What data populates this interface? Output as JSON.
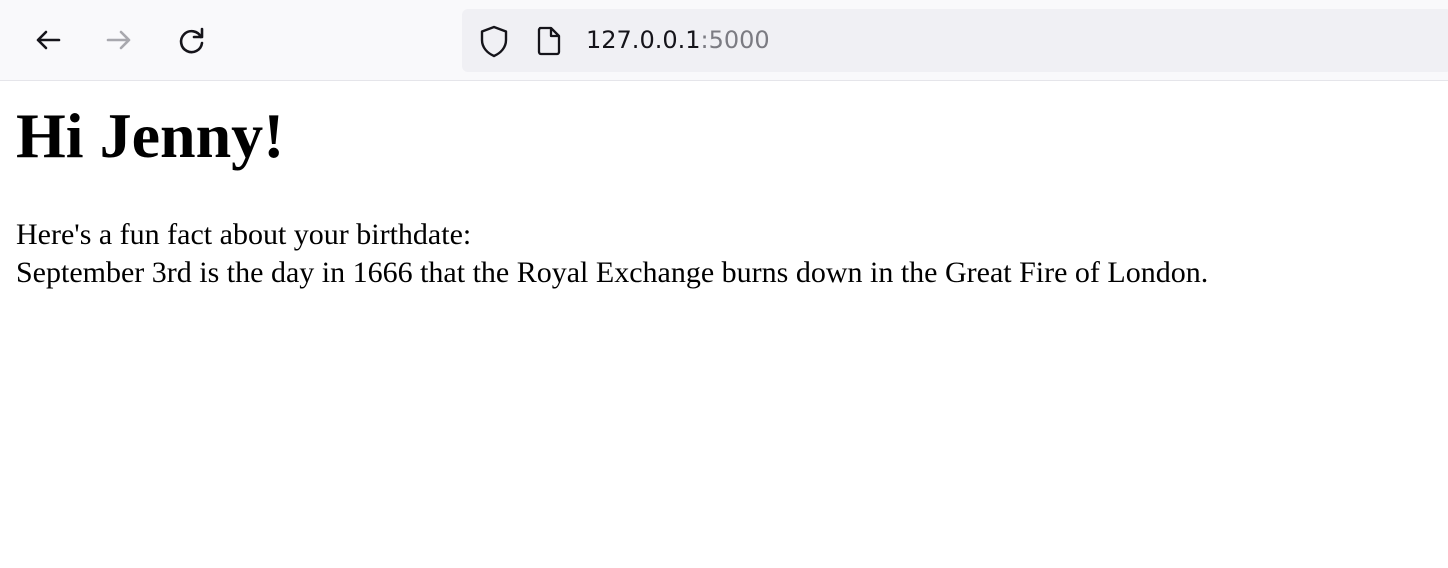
{
  "browser": {
    "url_host": "127.0.0.1",
    "url_port": ":5000",
    "icons": {
      "back": "back-arrow-icon",
      "forward": "forward-arrow-icon",
      "reload": "reload-icon",
      "tracking_protection": "shield-icon",
      "page_info": "page-icon"
    },
    "colors": {
      "toolbar_bg": "#f9f9fb",
      "urlbar_bg": "#f0f0f4",
      "icon": "#15141a",
      "icon_disabled": "#a8a8ae",
      "port_text": "#7b7b82"
    }
  },
  "page": {
    "heading": "Hi Jenny!",
    "intro": "Here's a fun fact about your birthdate:",
    "fact": "September 3rd is the day in 1666 that the Royal Exchange burns down in the Great Fire of London."
  }
}
